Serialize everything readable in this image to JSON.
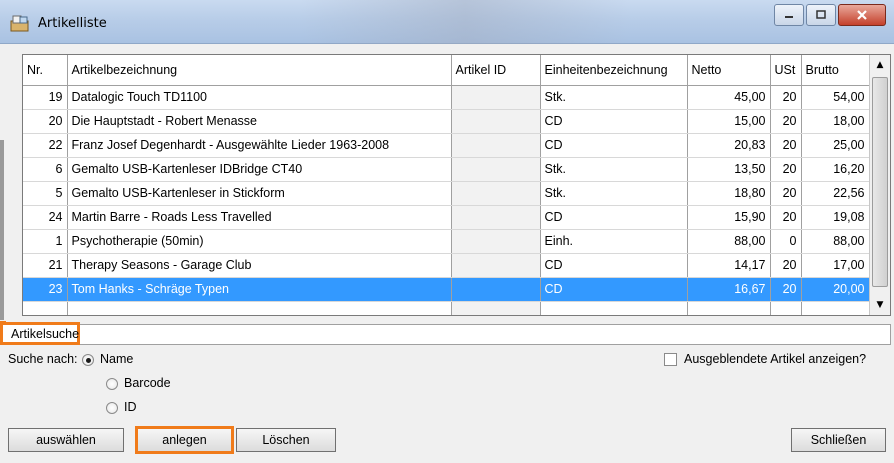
{
  "window": {
    "title": "Artikelliste",
    "icon": "app-icon",
    "controls": [
      "minimize-icon",
      "maximize-icon",
      "close-icon"
    ]
  },
  "table": {
    "columns": [
      "Nr.",
      "Artikelbezeichnung",
      "Artikel ID",
      "Einheitenbezeichnung",
      "Netto",
      "USt",
      "Brutto"
    ],
    "rows": [
      {
        "nr": "19",
        "name": "Datalogic Touch TD1100",
        "id": "",
        "unit": "Stk.",
        "netto": "45,00",
        "ust": "20",
        "brutto": "54,00"
      },
      {
        "nr": "20",
        "name": "Die Hauptstadt - Robert Menasse",
        "id": "",
        "unit": "CD",
        "netto": "15,00",
        "ust": "20",
        "brutto": "18,00"
      },
      {
        "nr": "22",
        "name": "Franz Josef Degenhardt - Ausgewählte Lieder 1963-2008",
        "id": "",
        "unit": "CD",
        "netto": "20,83",
        "ust": "20",
        "brutto": "25,00"
      },
      {
        "nr": "6",
        "name": "Gemalto USB-Kartenleser IDBridge CT40",
        "id": "",
        "unit": "Stk.",
        "netto": "13,50",
        "ust": "20",
        "brutto": "16,20"
      },
      {
        "nr": "5",
        "name": "Gemalto USB-Kartenleser in Stickform",
        "id": "",
        "unit": "Stk.",
        "netto": "18,80",
        "ust": "20",
        "brutto": "22,56"
      },
      {
        "nr": "24",
        "name": "Martin Barre - Roads Less Travelled",
        "id": "",
        "unit": "CD",
        "netto": "15,90",
        "ust": "20",
        "brutto": "19,08"
      },
      {
        "nr": "1",
        "name": "Psychotherapie (50min)",
        "id": "",
        "unit": "Einh.",
        "netto": "88,00",
        "ust": "0",
        "brutto": "88,00"
      },
      {
        "nr": "21",
        "name": "Therapy Seasons - Garage Club",
        "id": "",
        "unit": "CD",
        "netto": "14,17",
        "ust": "20",
        "brutto": "17,00"
      },
      {
        "nr": "23",
        "name": "Tom Hanks - Schräge Typen",
        "id": "",
        "unit": "CD",
        "netto": "16,67",
        "ust": "20",
        "brutto": "20,00",
        "selected": true
      }
    ]
  },
  "search": {
    "label": "Artikelsuche:",
    "value": "",
    "search_by_label": "Suche nach:",
    "options": [
      "Name",
      "Barcode",
      "ID"
    ],
    "selected_option": "Name",
    "show_hidden_label": "Ausgeblendete Artikel anzeigen?",
    "show_hidden_checked": false
  },
  "buttons": {
    "select": "auswählen",
    "create": "anlegen",
    "delete": "Löschen",
    "close": "Schließen"
  },
  "colors": {
    "selection": "#3399ff",
    "highlight": "#f07b1a"
  }
}
